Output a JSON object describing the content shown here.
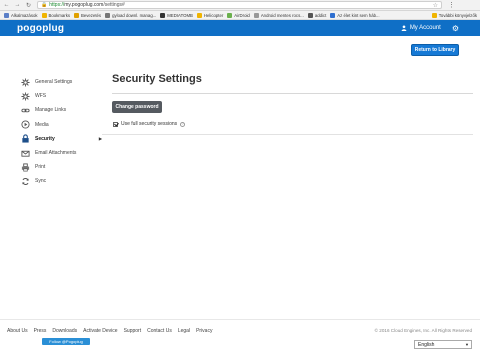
{
  "browser": {
    "url_secure": "https://",
    "url_host": "my.pogoplug.com",
    "url_path": "/settings#"
  },
  "bookmarks": [
    {
      "label": "Alkalmazások",
      "color": "#5b7fc7"
    },
    {
      "label": "Bookmarks",
      "color": "#f0b400"
    },
    {
      "label": "Bevezetés",
      "color": "#e0a000"
    },
    {
      "label": "gyload downl. manag...",
      "color": "#777777"
    },
    {
      "label": "MEDIATOMB",
      "color": "#333333"
    },
    {
      "label": "Helicopter",
      "color": "#f0b400"
    },
    {
      "label": "AirDroid",
      "color": "#6ab04c"
    },
    {
      "label": "Android mentes rocs...",
      "color": "#999999"
    },
    {
      "label": "addict",
      "color": "#555555"
    },
    {
      "label": "Az élet kint sem háb...",
      "color": "#2e6fd0"
    }
  ],
  "bookmarks_more": "További könyvjelzők",
  "header": {
    "logo": "pogoplug",
    "account_label": "My Account",
    "return_button": "Return to Library"
  },
  "sidebar": {
    "items": [
      {
        "label": "General Settings",
        "icon": "gear-icon"
      },
      {
        "label": "WFS",
        "icon": "gear-icon"
      },
      {
        "label": "Manage Links",
        "icon": "link-icon"
      },
      {
        "label": "Media",
        "icon": "media-icon"
      },
      {
        "label": "Security",
        "icon": "lock-icon",
        "active": true
      },
      {
        "label": "Email Attachments",
        "icon": "mail-icon"
      },
      {
        "label": "Print",
        "icon": "printer-icon"
      },
      {
        "label": "Sync",
        "icon": "sync-icon"
      }
    ]
  },
  "main": {
    "title": "Security Settings",
    "change_password_button": "Change password",
    "ssl_label": "Use full security sessions",
    "ssl_checked": true
  },
  "footer": {
    "links": [
      "About Us",
      "Press",
      "Downloads",
      "Activate Device",
      "Support",
      "Contact Us",
      "Legal",
      "Privacy"
    ],
    "copyright": "© 2016 Cloud Engines, Inc. All Rights Reserved",
    "twitter_button": "Follow @Pogoplug",
    "language": "English"
  },
  "colors": {
    "brand": "#0f6fc6",
    "button_primary": "#1679d5",
    "button_secondary": "#555a60"
  }
}
